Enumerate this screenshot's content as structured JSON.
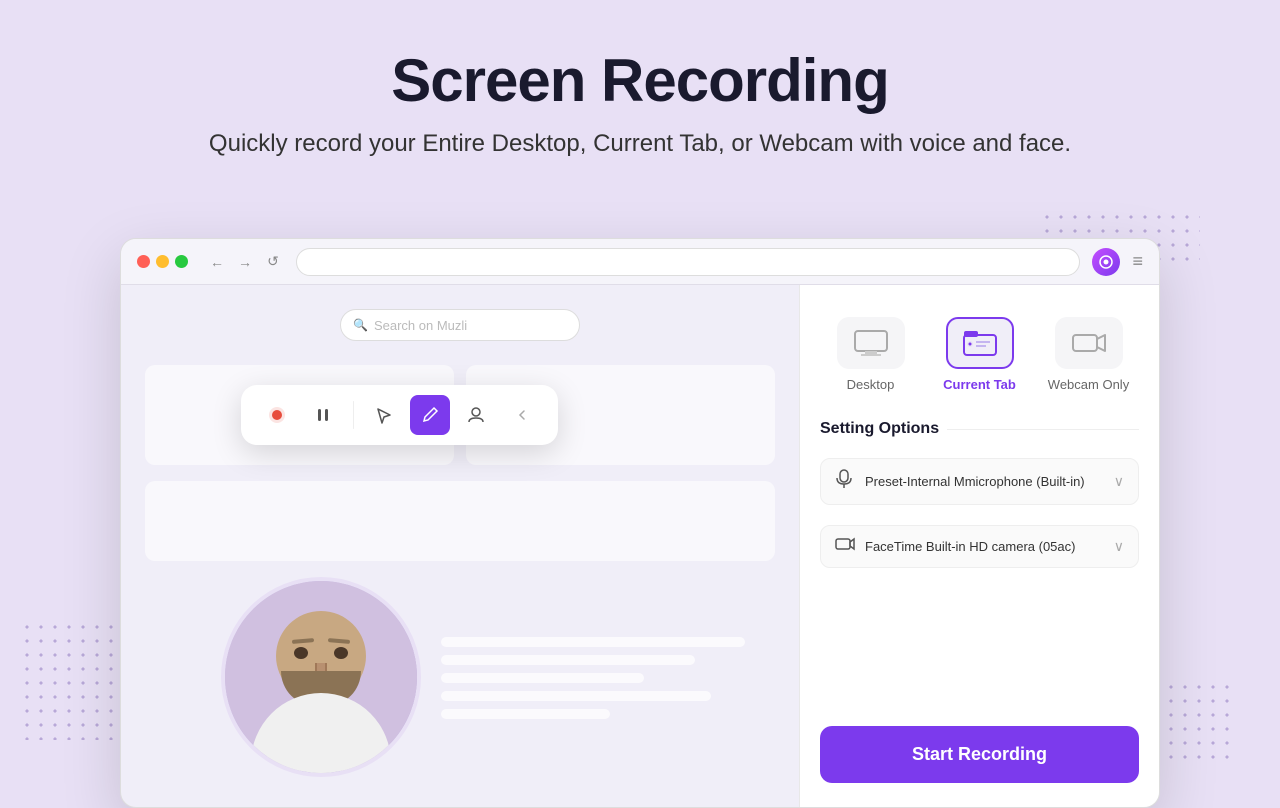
{
  "page": {
    "title": "Screen Recording",
    "subtitle": "Quickly record your Entire Desktop, Current Tab, or Webcam with voice and face."
  },
  "browser": {
    "search_placeholder": "Search on Muzli",
    "address": "",
    "nav": {
      "back": "←",
      "forward": "→",
      "refresh": "↺"
    },
    "menu": "≡"
  },
  "modes": [
    {
      "id": "desktop",
      "label": "Desktop",
      "active": false
    },
    {
      "id": "current-tab",
      "label": "Current Tab",
      "active": true
    },
    {
      "id": "webcam-only",
      "label": "Webcam Only",
      "active": false
    }
  ],
  "settings": {
    "title": "Setting Options",
    "microphone": {
      "label": "Preset-Internal Mmicrophone  (Built-in)"
    },
    "camera": {
      "label": "FaceTime Built-in HD camera  (05ac)"
    }
  },
  "toolbar": {
    "buttons": [
      "record",
      "pause",
      "arrow",
      "pen",
      "user",
      "close"
    ]
  },
  "actions": {
    "start_recording": "Start Recording"
  },
  "colors": {
    "accent": "#7c3aed",
    "accent_light": "#f0eef8",
    "background": "#e8e0f5"
  }
}
